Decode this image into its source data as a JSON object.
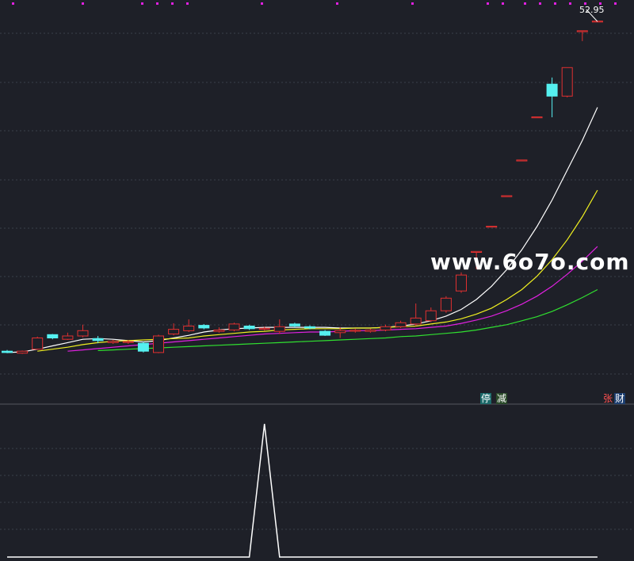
{
  "watermark": "www.6o7o.com",
  "markers": {
    "stop": "停",
    "cut": "减",
    "rise": "张",
    "fin": "财"
  },
  "price_label": "52.95",
  "colors": {
    "background": "#1e2028",
    "grid": "#3a3f4a",
    "up": "#e03030",
    "down": "#55f0f0",
    "ma_white": "#ffffff",
    "ma_yellow": "#f0f020",
    "ma_magenta": "#e020e0",
    "ma_green": "#30e030",
    "indicator": "#ffffff",
    "top_dots": "#e020e0"
  },
  "chart_data": [
    {
      "type": "candlestick",
      "title": "",
      "max_price": 52.95,
      "ylim": [
        0,
        55
      ],
      "grid": true,
      "candles": [
        {
          "o": 3.2,
          "c": 3.0,
          "h": 3.4,
          "l": 2.9
        },
        {
          "o": 2.9,
          "c": 3.2,
          "h": 3.3,
          "l": 2.8
        },
        {
          "o": 3.5,
          "c": 5.2,
          "h": 5.4,
          "l": 3.4
        },
        {
          "o": 5.7,
          "c": 5.2,
          "h": 5.8,
          "l": 5.0
        },
        {
          "o": 5.0,
          "c": 5.5,
          "h": 6.0,
          "l": 4.9
        },
        {
          "o": 5.5,
          "c": 6.3,
          "h": 7.2,
          "l": 5.3
        },
        {
          "o": 5.1,
          "c": 4.8,
          "h": 5.5,
          "l": 4.4
        },
        {
          "o": 4.5,
          "c": 4.7,
          "h": 4.9,
          "l": 4.3
        },
        {
          "o": 4.5,
          "c": 4.6,
          "h": 4.9,
          "l": 4.3
        },
        {
          "o": 4.4,
          "c": 3.2,
          "h": 4.6,
          "l": 3.0
        },
        {
          "o": 3.0,
          "c": 5.5,
          "h": 5.7,
          "l": 2.9
        },
        {
          "o": 5.8,
          "c": 6.5,
          "h": 7.4,
          "l": 5.6
        },
        {
          "o": 6.3,
          "c": 7.0,
          "h": 8.0,
          "l": 6.1
        },
        {
          "o": 7.1,
          "c": 6.7,
          "h": 7.3,
          "l": 6.5
        },
        {
          "o": 6.2,
          "c": 6.4,
          "h": 6.8,
          "l": 6.0
        },
        {
          "o": 6.4,
          "c": 7.3,
          "h": 7.5,
          "l": 6.2
        },
        {
          "o": 7.0,
          "c": 6.6,
          "h": 7.2,
          "l": 6.4
        },
        {
          "o": 6.5,
          "c": 6.6,
          "h": 6.9,
          "l": 6.3
        },
        {
          "o": 6.2,
          "c": 6.9,
          "h": 8.0,
          "l": 5.8
        },
        {
          "o": 7.3,
          "c": 7.0,
          "h": 7.5,
          "l": 6.8
        },
        {
          "o": 6.9,
          "c": 6.7,
          "h": 7.1,
          "l": 6.5
        },
        {
          "o": 6.2,
          "c": 5.6,
          "h": 6.4,
          "l": 5.5
        },
        {
          "o": 6.0,
          "c": 6.3,
          "h": 6.8,
          "l": 5.2
        },
        {
          "o": 6.2,
          "c": 6.3,
          "h": 6.6,
          "l": 6.0
        },
        {
          "o": 6.2,
          "c": 6.4,
          "h": 6.6,
          "l": 6.0
        },
        {
          "o": 6.4,
          "c": 6.9,
          "h": 7.2,
          "l": 6.2
        },
        {
          "o": 6.9,
          "c": 7.5,
          "h": 7.8,
          "l": 6.7
        },
        {
          "o": 7.3,
          "c": 8.2,
          "h": 10.4,
          "l": 7.0
        },
        {
          "o": 7.8,
          "c": 9.3,
          "h": 9.8,
          "l": 7.6
        },
        {
          "o": 9.3,
          "c": 11.2,
          "h": 11.5,
          "l": 9.0
        },
        {
          "o": 12.3,
          "c": 14.7,
          "h": 15.1,
          "l": 12.0
        },
        {
          "o": 18.2,
          "c": 18.2,
          "h": 18.2,
          "l": 15.6
        },
        {
          "o": 22.0,
          "c": 22.0,
          "h": 22.0,
          "l": 22.0
        },
        {
          "o": 26.6,
          "c": 26.6,
          "h": 26.6,
          "l": 26.6
        },
        {
          "o": 32.0,
          "c": 32.0,
          "h": 32.0,
          "l": 32.0
        },
        {
          "o": 38.5,
          "c": 38.5,
          "h": 38.5,
          "l": 38.5
        },
        {
          "o": 43.5,
          "c": 41.7,
          "h": 44.5,
          "l": 38.5
        },
        {
          "o": 41.7,
          "c": 46.0,
          "h": 46.0,
          "l": 41.5
        },
        {
          "o": 51.5,
          "c": 51.5,
          "h": 51.5,
          "l": 50.0
        },
        {
          "o": 52.95,
          "c": 52.95,
          "h": 52.95,
          "l": 52.95
        }
      ],
      "moving_averages": [
        {
          "color": "ma_white",
          "values": [
            3.0,
            3.1,
            3.5,
            4.0,
            4.5,
            5.0,
            5.1,
            5.0,
            4.8,
            4.6,
            4.8,
            5.2,
            5.6,
            6.1,
            6.4,
            6.6,
            6.7,
            6.8,
            6.8,
            6.8,
            6.8,
            6.8,
            6.7,
            6.7,
            6.7,
            6.8,
            7.0,
            7.3,
            7.8,
            8.5,
            9.5,
            11.0,
            13.0,
            15.5,
            18.5,
            22.0,
            26.0,
            30.5,
            35.0,
            40.0
          ]
        },
        {
          "color": "ma_yellow",
          "values": [
            null,
            null,
            3.2,
            3.5,
            3.8,
            4.2,
            4.5,
            4.7,
            4.8,
            4.9,
            5.0,
            5.1,
            5.2,
            5.5,
            5.7,
            5.9,
            6.1,
            6.2,
            6.4,
            6.5,
            6.6,
            6.6,
            6.6,
            6.7,
            6.7,
            6.8,
            6.9,
            7.0,
            7.3,
            7.6,
            8.1,
            8.8,
            9.7,
            11.0,
            12.5,
            14.5,
            17.0,
            20.0,
            23.5,
            27.5
          ]
        },
        {
          "color": "ma_magenta",
          "values": [
            null,
            null,
            null,
            null,
            3.2,
            3.4,
            3.6,
            3.8,
            4.0,
            4.2,
            4.4,
            4.6,
            4.8,
            5.0,
            5.2,
            5.4,
            5.6,
            5.8,
            5.9,
            6.0,
            6.1,
            6.1,
            6.2,
            6.3,
            6.3,
            6.4,
            6.5,
            6.6,
            6.8,
            7.0,
            7.4,
            7.9,
            8.5,
            9.3,
            10.3,
            11.5,
            13.0,
            14.8,
            16.8,
            19.0
          ]
        },
        {
          "color": "ma_green",
          "values": [
            null,
            null,
            null,
            null,
            null,
            null,
            3.3,
            3.4,
            3.5,
            3.6,
            3.7,
            3.8,
            3.9,
            4.0,
            4.1,
            4.2,
            4.3,
            4.4,
            4.5,
            4.6,
            4.7,
            4.8,
            4.9,
            5.0,
            5.1,
            5.2,
            5.4,
            5.5,
            5.7,
            5.9,
            6.1,
            6.4,
            6.8,
            7.2,
            7.8,
            8.4,
            9.2,
            10.2,
            11.3,
            12.5
          ]
        }
      ]
    },
    {
      "type": "line",
      "title": "",
      "ylim": [
        0,
        1
      ],
      "grid": true,
      "values": [
        0,
        0,
        0,
        0,
        0,
        0,
        0,
        0,
        0,
        0,
        0,
        0,
        0,
        0,
        0,
        0,
        0,
        1,
        0,
        0,
        0,
        0,
        0,
        0,
        0,
        0,
        0,
        0,
        0,
        0,
        0,
        0,
        0,
        0,
        0,
        0,
        0,
        0,
        0,
        0
      ]
    }
  ]
}
